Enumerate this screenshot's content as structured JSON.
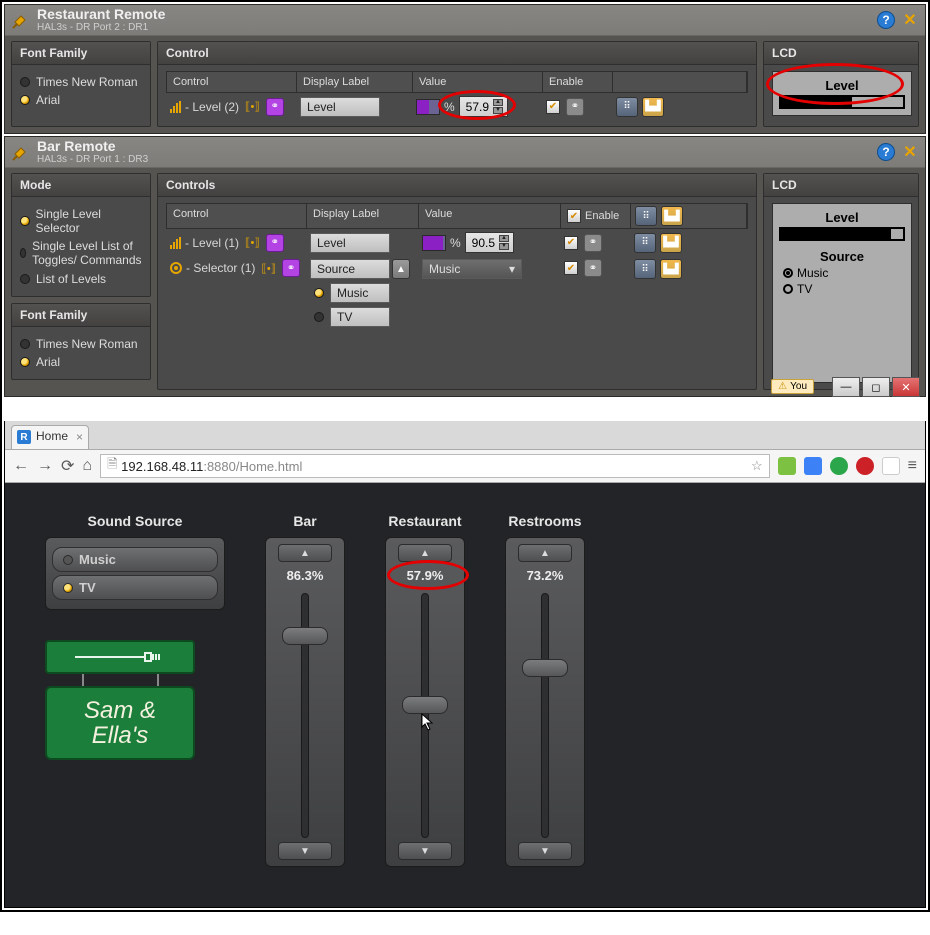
{
  "panel1": {
    "title": "Restaurant Remote",
    "subtitle": "HAL3s - DR Port 2  :  DR1",
    "font_family_header": "Font Family",
    "font_options": [
      "Times New Roman",
      "Arial"
    ],
    "font_selected": 1,
    "control_header": "Control",
    "headers": {
      "control": "Control",
      "display": "Display Label",
      "value": "Value",
      "enable": "Enable"
    },
    "row": {
      "name": "Level (2)",
      "display_label": "Level",
      "percent_symbol": "%",
      "value": "57.9"
    },
    "lcd_header": "LCD",
    "lcd_title": "Level",
    "lcd_fill_pct": 58
  },
  "panel2": {
    "title": "Bar Remote",
    "subtitle": "HAL3s - DR Port 1  :  DR3",
    "mode_header": "Mode",
    "mode_options": [
      "Single Level Selector",
      "Single Level List of Toggles/ Commands",
      "List of Levels"
    ],
    "mode_selected": 0,
    "font_family_header": "Font Family",
    "font_options": [
      "Times New Roman",
      "Arial"
    ],
    "font_selected": 1,
    "controls_header": "Controls",
    "headers": {
      "control": "Control",
      "display": "Display Label",
      "value": "Value",
      "enable": "Enable"
    },
    "rows": [
      {
        "name": "Level (1)",
        "display": "Level",
        "percent": "%",
        "value": "90.5"
      },
      {
        "name": "Selector (1)",
        "display": "Source",
        "value": "Music",
        "options": [
          "Music",
          "TV"
        ],
        "option_selected": 0
      }
    ],
    "lcd_header": "LCD",
    "lcd_level_title": "Level",
    "lcd_level_fill_pct": 90,
    "lcd_source_title": "Source",
    "lcd_source_options": [
      "Music",
      "TV"
    ],
    "lcd_source_selected": 0
  },
  "browser": {
    "you_label": "You",
    "tab_title": "Home",
    "url_host": "192.168.48.11",
    "url_port": ":8880",
    "url_path": "/Home.html",
    "page": {
      "source_header": "Sound Source",
      "sources": [
        "Music",
        "TV"
      ],
      "source_selected": 1,
      "sliders": [
        {
          "name": "Bar",
          "pct": "86.3%",
          "pos": 13.7
        },
        {
          "name": "Restaurant",
          "pct": "57.9%",
          "pos": 42.1
        },
        {
          "name": "Restrooms",
          "pct": "73.2%",
          "pos": 26.8
        }
      ],
      "logo_line1": "Sam &",
      "logo_line2": "Ella's"
    }
  }
}
